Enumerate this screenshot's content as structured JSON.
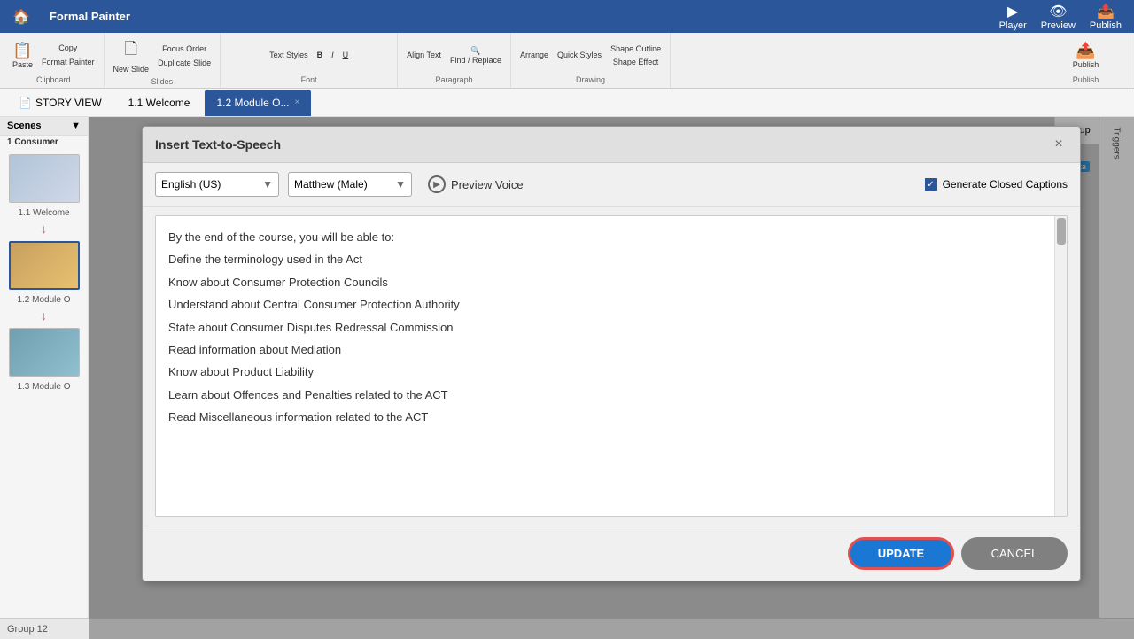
{
  "app": {
    "title": "Formal Painter"
  },
  "topbar": {
    "paste_label": "Paste",
    "copy_label": "Copy",
    "format_painter_label": "Format Painter",
    "clipboard_label": "Clipboard",
    "new_slide_label": "New Slide",
    "focus_order_label": "Focus Order",
    "duplicate_slide_label": "Duplicate Slide",
    "slides_label": "Slides",
    "text_styles_label": "Text Styles",
    "bold_label": "B",
    "italic_label": "I",
    "underline_label": "U",
    "font_label": "Font",
    "align_text_label": "Align Text",
    "find_replace_label": "Find / Replace",
    "paragraph_label": "Paragraph",
    "arrange_label": "Arrange",
    "quick_styles_label": "Quick Styles",
    "shape_outline_label": "Shape Outline",
    "shape_effect_label": "Shape Effect",
    "drawing_label": "Drawing",
    "player_label": "Player",
    "preview_label": "Preview",
    "publish_label": "Publish",
    "publish_section_label": "Publish"
  },
  "nav": {
    "story_view_label": "STORY VIEW",
    "tab1_label": "1.1 Welcome",
    "tab2_label": "1.2 Module O...",
    "tab2_close": "×"
  },
  "scenes": {
    "header_label": "Scenes",
    "collapse_icon": "▼",
    "consumer_label": "1 Consumer",
    "scenes_list": [
      {
        "id": "s1",
        "label": "1.1 Welcome",
        "active": false
      },
      {
        "id": "s2",
        "label": "1.2 Module O",
        "active": true
      },
      {
        "id": "s3",
        "label": "1.3 Module O",
        "active": false
      }
    ]
  },
  "right_panel": {
    "triggers_label": "Triggers",
    "group_label": "Group",
    "beta_label": "Beta"
  },
  "modal": {
    "title": "Insert Text-to-Speech",
    "close_icon": "×",
    "language_label": "English (US)",
    "voice_label": "Matthew (Male)",
    "preview_voice_label": "Preview Voice",
    "generate_captions_label": "Generate Closed Captions",
    "text_content": [
      "By the end of the course, you will be able to:",
      "Define the terminology used in the Act",
      "Know about Consumer Protection Councils",
      "Understand about Central Consumer Protection Authority",
      "State about Consumer Disputes Redressal Commission",
      "Read information about Mediation",
      "Know about Product Liability",
      "Learn about Offences and Penalties related to the ACT",
      "Read Miscellaneous information related to the ACT"
    ],
    "update_label": "UPDATE",
    "cancel_label": "CANCEL"
  },
  "bottom_bar": {
    "group_label": "Group 12"
  }
}
